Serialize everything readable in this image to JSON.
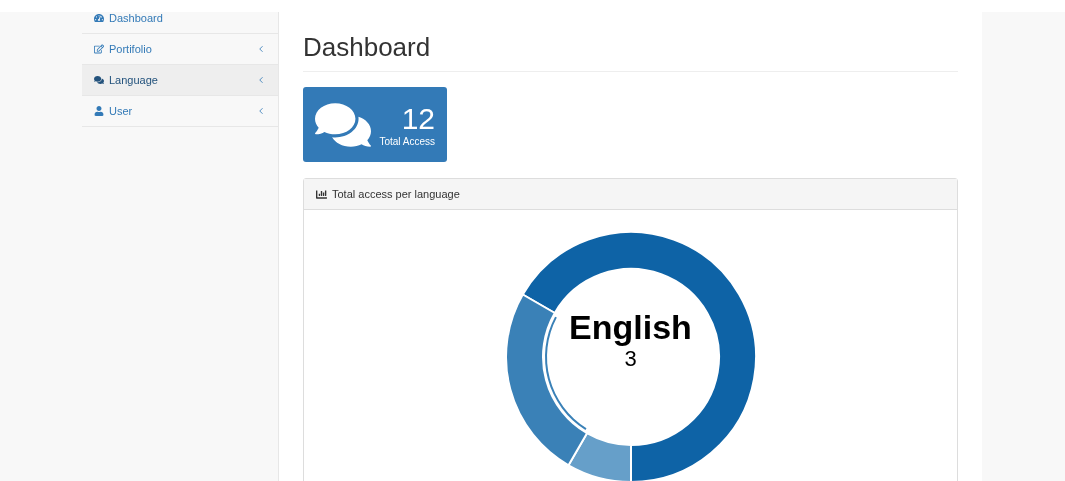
{
  "sidebar": {
    "items": [
      {
        "label": "Dashboard",
        "expandable": false,
        "selected": false
      },
      {
        "label": "Portifolio",
        "expandable": true,
        "selected": false
      },
      {
        "label": "Language",
        "expandable": true,
        "selected": true
      },
      {
        "label": "User",
        "expandable": true,
        "selected": false
      }
    ]
  },
  "page_title": "Dashboard",
  "stat_tile": {
    "value": "12",
    "label": "Total Access"
  },
  "panel": {
    "title": "Total access per language",
    "chart": {
      "kind": "picture",
      "center_label": "English",
      "center_value": "3"
    }
  }
}
